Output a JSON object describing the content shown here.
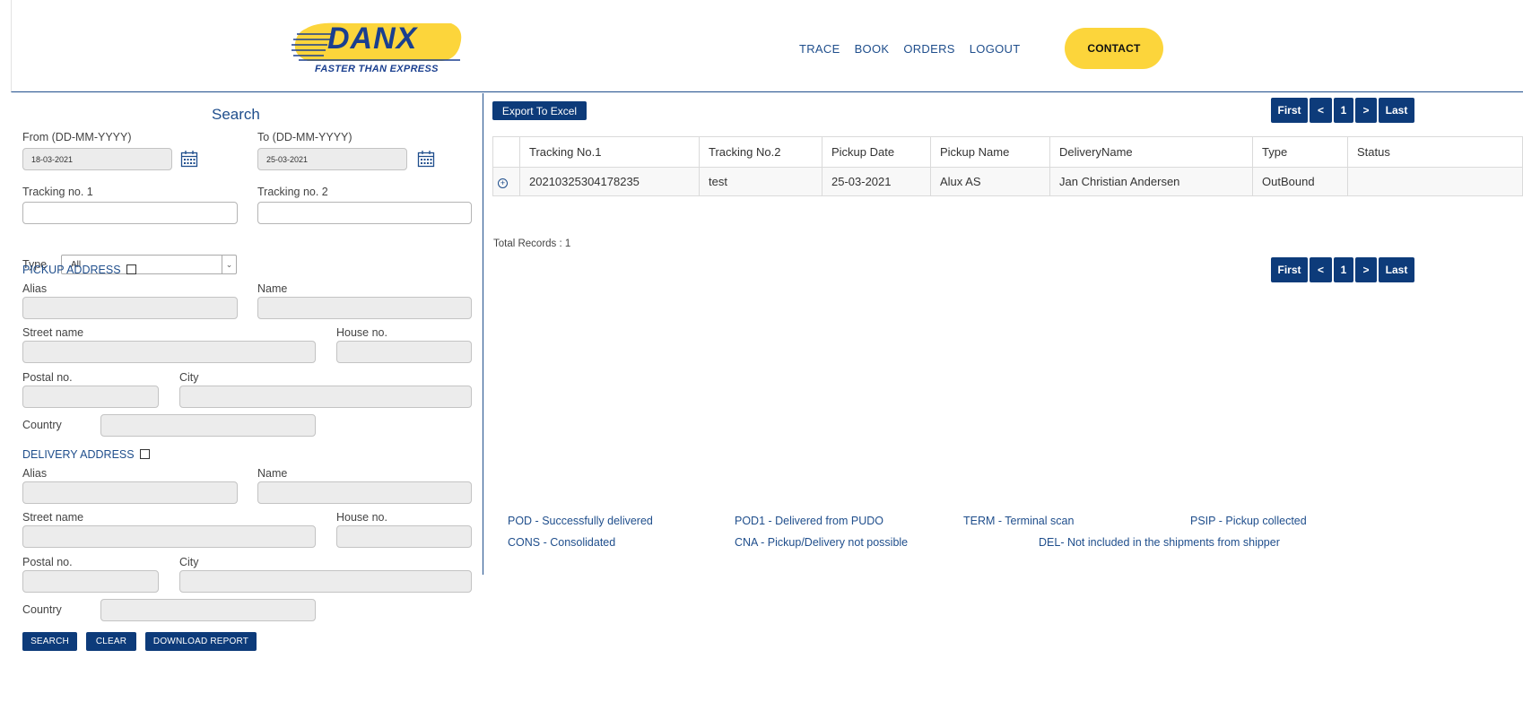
{
  "header": {
    "logo_text": "DANX",
    "logo_tagline": "FASTER THAN EXPRESS",
    "nav": [
      "TRACE",
      "BOOK",
      "ORDERS",
      "LOGOUT"
    ],
    "contact_label": "CONTACT",
    "colors": {
      "brand": "#1a3f8f",
      "accent": "#fcd53b"
    }
  },
  "search": {
    "title": "Search",
    "from_label": "From (DD-MM-YYYY)",
    "from_value": "18-03-2021",
    "to_label": "To (DD-MM-YYYY)",
    "to_value": "25-03-2021",
    "tracking1_label": "Tracking no. 1",
    "tracking2_label": "Tracking no. 2",
    "type_label": "Type",
    "type_value": "All",
    "pickup": {
      "heading": "PICKUP ADDRESS",
      "alias": "Alias",
      "name": "Name",
      "street": "Street name",
      "house": "House no.",
      "postal": "Postal no.",
      "city": "City",
      "country": "Country"
    },
    "delivery": {
      "heading": "DELIVERY ADDRESS",
      "alias": "Alias",
      "name": "Name",
      "street": "Street name",
      "house": "House no.",
      "postal": "Postal no.",
      "city": "City",
      "country": "Country"
    },
    "buttons": {
      "search": "SEARCH",
      "clear": "CLEAR",
      "download": "DOWNLOAD REPORT"
    }
  },
  "results": {
    "export_label": "Export To Excel",
    "pager": {
      "first": "First",
      "prev": "<",
      "page": "1",
      "next": ">",
      "last": "Last"
    },
    "columns": [
      "Tracking No.1",
      "Tracking No.2",
      "Pickup Date",
      "Pickup Name",
      "DeliveryName",
      "Type",
      "Status"
    ],
    "rows": [
      [
        "20210325304178235",
        "test",
        "25-03-2021",
        "Alux AS",
        "Jan Christian Andersen",
        "OutBound",
        ""
      ]
    ],
    "total_records": "Total Records : 1"
  },
  "legend": {
    "pod": "POD - Successfully delivered",
    "pod1": "POD1 - Delivered from PUDO",
    "term": "TERM - Terminal scan",
    "psip": "PSIP - Pickup collected",
    "cons": "CONS - Consolidated",
    "cna": "CNA - Pickup/Delivery not possible",
    "del": "DEL- Not included in the shipments from shipper"
  }
}
